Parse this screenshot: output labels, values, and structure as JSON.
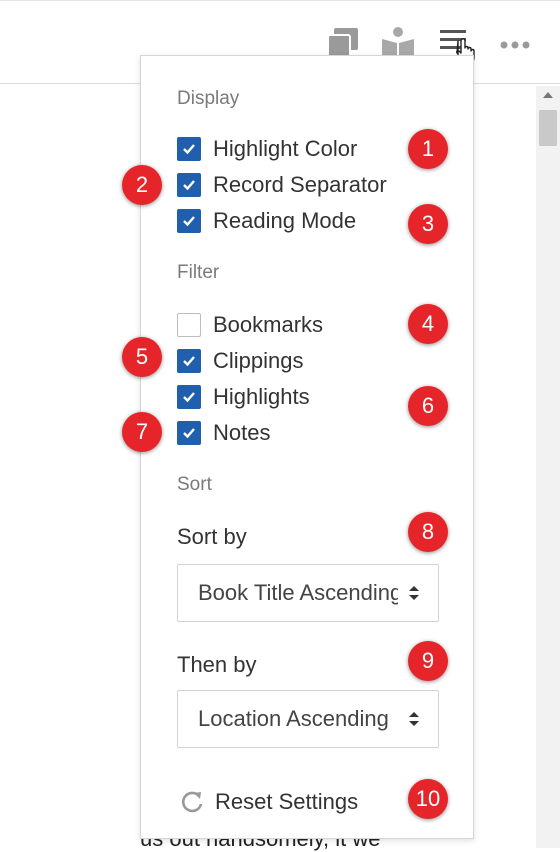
{
  "background_text": "us out handsomely, it we",
  "toolbar": {
    "icons": [
      "copy-icon",
      "reading-icon",
      "menu-icon",
      "more-icon"
    ]
  },
  "menu": {
    "display": {
      "heading": "Display",
      "options": [
        {
          "label": "Highlight Color",
          "checked": true
        },
        {
          "label": "Record Separator",
          "checked": true
        },
        {
          "label": "Reading Mode",
          "checked": true
        }
      ]
    },
    "filter": {
      "heading": "Filter",
      "options": [
        {
          "label": "Bookmarks",
          "checked": false
        },
        {
          "label": "Clippings",
          "checked": true
        },
        {
          "label": "Highlights",
          "checked": true
        },
        {
          "label": "Notes",
          "checked": true
        }
      ]
    },
    "sort": {
      "heading": "Sort",
      "sort_by_label": "Sort by",
      "sort_by_value": "Book Title Ascending",
      "then_by_label": "Then by",
      "then_by_value": "Location Ascending"
    },
    "reset_label": "Reset Settings"
  },
  "badges": [
    "1",
    "2",
    "3",
    "4",
    "5",
    "6",
    "7",
    "8",
    "9",
    "10"
  ],
  "colors": {
    "accent": "#1f5fae",
    "badge": "#e5252a"
  }
}
